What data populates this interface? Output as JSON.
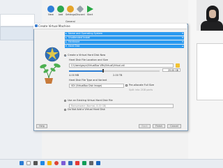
{
  "manager": {
    "toolbar": [
      {
        "label": "New",
        "color": "#2f7fd8"
      },
      {
        "label": "Add",
        "color": "#2fa84f"
      },
      {
        "label": "Settings",
        "color": "#e5a52a"
      },
      {
        "label": "Discard",
        "color": "#9aa3ab"
      },
      {
        "label": "Start",
        "color": "#27a844"
      }
    ],
    "general_label": "General"
  },
  "dialog": {
    "title": "Create Virtual Machine",
    "sections": [
      {
        "label": "Name and Operating System"
      },
      {
        "label": "Unattended Install"
      },
      {
        "label": "Hardware"
      },
      {
        "label": "Hard Disk"
      }
    ],
    "create_new_label": "Create a Virtual Hard Disk Now",
    "location_size_label": "Hard Disk File Location and Size",
    "location_value": "C:\\Users\\gwyn\\VirtualBox VMs\\Virtual\\Virtual.vdi",
    "size_value": "25.00 GB",
    "slider_min": "4.00 MB",
    "slider_max": "2.00 TB",
    "slider_fraction": 0.38,
    "type_variant_label": "Hard Disk File Type and Variant",
    "type_value": "VDI (VirtualBox Disk Image)",
    "preallocate_label": "Pre-allocate Full Size",
    "split_label": "Split into 2GB parts",
    "use_existing_label": "Use an Existing Virtual Hard Disk File",
    "existing_value": "Ransomware (Normal, 8.00 GB)",
    "no_disk_label": "Do Not Add a Virtual Hard Disk",
    "help_label": "Help",
    "back_label": "Back",
    "finish_label": "Finish",
    "cancel_label": "Cancel"
  },
  "colors": {
    "accent": "#2b9af0",
    "selection": "#2b7cd3"
  }
}
